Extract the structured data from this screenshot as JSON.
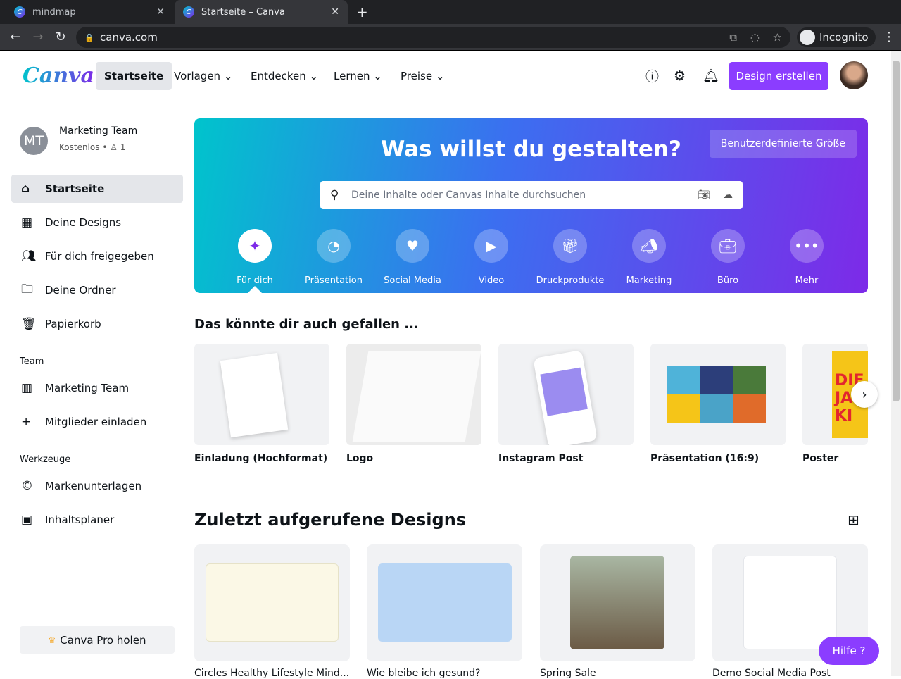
{
  "browser": {
    "tabs": [
      {
        "title": "mindmap"
      },
      {
        "title": "Startseite – Canva"
      }
    ],
    "url": "canva.com",
    "incognito": "Incognito"
  },
  "header": {
    "logo": "Canva",
    "nav": [
      "Startseite",
      "Vorlagen",
      "Entdecken",
      "Lernen",
      "Preise"
    ],
    "cta": "Design erstellen"
  },
  "team": {
    "initials": "MT",
    "name": "Marketing Team",
    "plan": "Kostenlos",
    "members": "1"
  },
  "sidebar": {
    "items": [
      "Startseite",
      "Deine Designs",
      "Für dich freigegeben",
      "Deine Ordner",
      "Papierkorb"
    ],
    "team_heading": "Team",
    "team_items": [
      "Marketing Team",
      "Mitglieder einladen"
    ],
    "tools_heading": "Werkzeuge",
    "tools_items": [
      "Markenunterlagen",
      "Inhaltsplaner"
    ],
    "pro": "Canva Pro holen"
  },
  "hero": {
    "title": "Was willst du gestalten?",
    "custom": "Benutzerdefinierte Größe",
    "search_placeholder": "Deine Inhalte oder Canvas Inhalte durchsuchen",
    "categories": [
      "Für dich",
      "Präsentation",
      "Social Media",
      "Video",
      "Druckprodukte",
      "Marketing",
      "Büro",
      "Mehr"
    ]
  },
  "suggest": {
    "title": "Das könnte dir auch gefallen ...",
    "items": [
      "Einladung (Hochformat)",
      "Logo",
      "Instagram Post",
      "Präsentation (16:9)",
      "Poster"
    ]
  },
  "recent": {
    "title": "Zuletzt aufgerufene Designs",
    "items": [
      "Circles Healthy Lifestyle Mind...",
      "Wie bleibe ich gesund?",
      "Spring Sale",
      "Demo Social Media Post"
    ]
  },
  "help": "Hilfe  ?"
}
